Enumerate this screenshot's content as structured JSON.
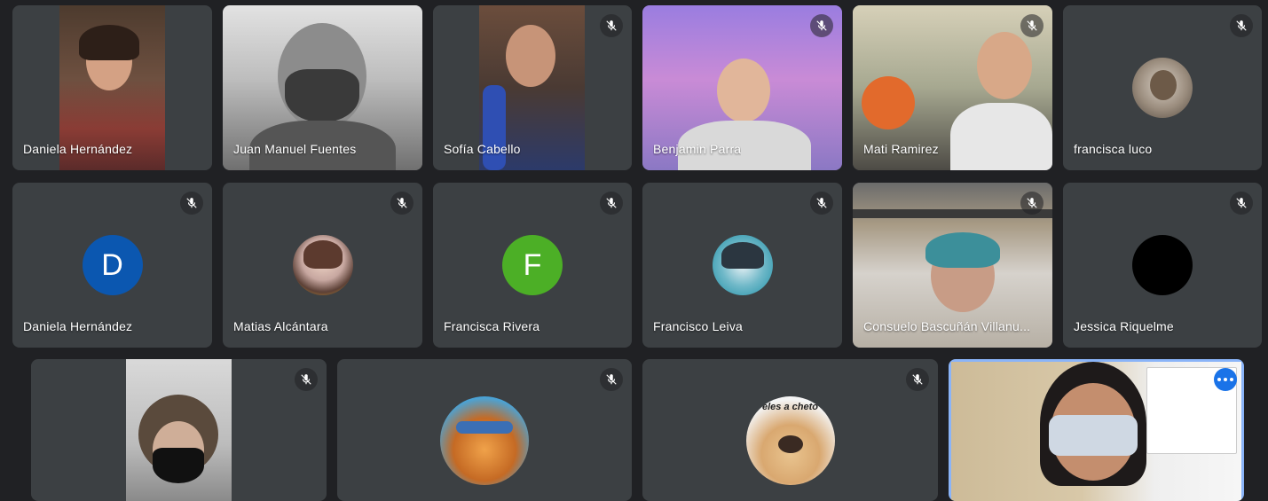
{
  "participants": [
    {
      "name": "Daniela Hernández",
      "video": true,
      "muted": false
    },
    {
      "name": "Juan Manuel Fuentes",
      "video": true,
      "muted": false
    },
    {
      "name": "Sofía Cabello",
      "video": true,
      "muted": true
    },
    {
      "name": "Benjamin Parra",
      "video": true,
      "muted": true
    },
    {
      "name": "Mati Ramirez",
      "video": true,
      "muted": true
    },
    {
      "name": "francisca luco",
      "video": false,
      "muted": true,
      "avatar": "cat-photo"
    },
    {
      "name": "Daniela Hernández",
      "video": false,
      "muted": true,
      "avatar_letter": "D",
      "avatar_color": "#0b57b0"
    },
    {
      "name": "Matias Alcántara",
      "video": false,
      "muted": true,
      "avatar": "anime-girl-photo"
    },
    {
      "name": "Francisca Rivera",
      "video": false,
      "muted": true,
      "avatar_letter": "F",
      "avatar_color": "#4caf26"
    },
    {
      "name": "Francisco Leiva",
      "video": false,
      "muted": true,
      "avatar": "anime-boy-photo"
    },
    {
      "name": "Consuelo Bascuñán Villanu...",
      "video": true,
      "muted": true
    },
    {
      "name": "Jessica Riquelme",
      "video": false,
      "muted": true,
      "avatar_color": "#000000"
    },
    {
      "name": "",
      "video": true,
      "muted": true
    },
    {
      "name": "",
      "video": false,
      "muted": true,
      "avatar": "cartoon-character-photo"
    },
    {
      "name": "",
      "video": false,
      "muted": true,
      "avatar": "puppy-photo",
      "avatar_text": "eles a cheto"
    },
    {
      "name": "",
      "video": true,
      "muted": false,
      "highlighted": true
    }
  ],
  "colors": {
    "background": "#202124",
    "tile": "#3c4043",
    "accent": "#8ab4f8",
    "more_button": "#1a73e8"
  }
}
